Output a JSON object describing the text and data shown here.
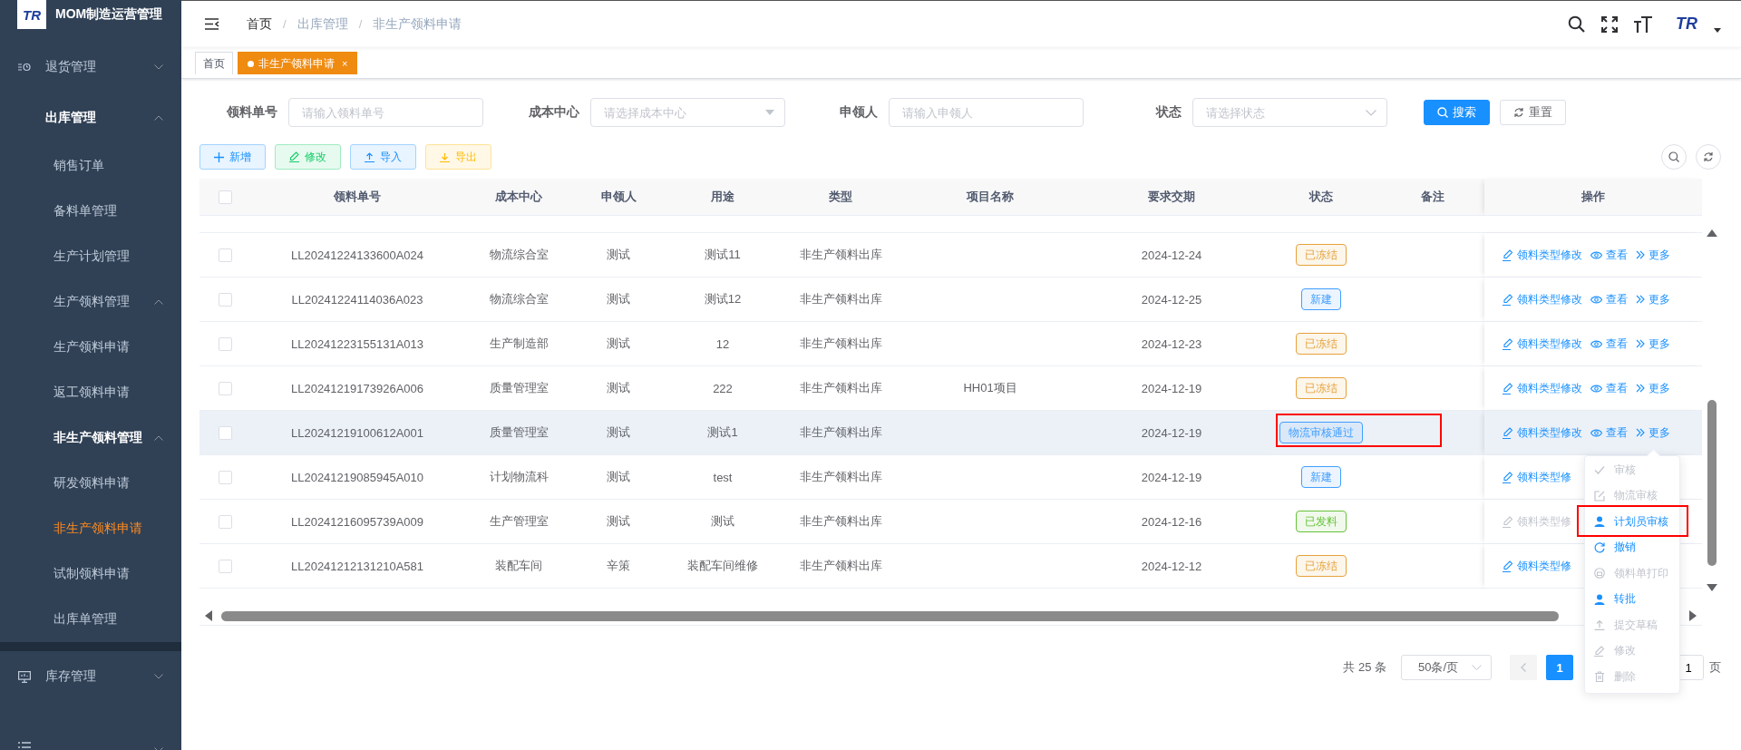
{
  "app": {
    "logo": "TR",
    "title": "MOM制造运营管理"
  },
  "menu": [
    {
      "label": "退货管理",
      "expanded": false
    },
    {
      "label": "出库管理",
      "expanded": true,
      "children": [
        {
          "label": "销售订单",
          "selected": false
        },
        {
          "label": "备料单管理",
          "selected": false
        },
        {
          "label": "生产计划管理",
          "selected": false
        },
        {
          "label": "生产领料管理",
          "expanded": true,
          "children": [
            {
              "label": "生产领料申请",
              "selected": false
            },
            {
              "label": "返工领料申请",
              "selected": false
            }
          ]
        },
        {
          "label": "非生产领料管理",
          "expanded": true,
          "children": [
            {
              "label": "研发领料申请",
              "selected": false
            },
            {
              "label": "非生产领料申请",
              "selected": true
            },
            {
              "label": "试制领料申请",
              "selected": false
            }
          ]
        },
        {
          "label": "出库单管理",
          "selected": false
        }
      ]
    },
    {
      "label": "库存管理",
      "expanded": false
    }
  ],
  "breadcrumb": [
    {
      "label": "首页"
    },
    {
      "separator": "/",
      "label": "出库管理"
    },
    {
      "separator": "/",
      "label": "非生产领料申请"
    }
  ],
  "header_logo": "TR",
  "tabs": [
    {
      "label": "首页",
      "selected": false
    },
    {
      "label": "非生产领料申请",
      "selected": true,
      "close": "×"
    }
  ],
  "filters": [
    {
      "label": "领料单号",
      "placeholder": "请输入领料单号",
      "kind": "input"
    },
    {
      "label": "成本中心",
      "placeholder": "请选择成本中心",
      "kind": "tree-select"
    },
    {
      "label": "申领人",
      "placeholder": "请输入申领人",
      "kind": "input"
    },
    {
      "label": "状态",
      "placeholder": "请选择状态",
      "kind": "select"
    }
  ],
  "search_buttons": [
    {
      "label": "搜索",
      "kind": "primary"
    },
    {
      "label": "重置",
      "kind": "default"
    }
  ],
  "toolbar": [
    {
      "label": "新增",
      "kind": "add"
    },
    {
      "label": "修改",
      "kind": "edit"
    },
    {
      "label": "导入",
      "kind": "import"
    },
    {
      "label": "导出",
      "kind": "export"
    }
  ],
  "table": {
    "all_checked": false,
    "columns": [
      "领料单号",
      "成本中心",
      "申领人",
      "用途",
      "类型",
      "项目名称",
      "要求交期",
      "状态",
      "备注",
      "操作"
    ],
    "rows": [
      {
        "checked": false,
        "hovered": false,
        "no": "LL20241224133600A024",
        "cost_center": "物流综合室",
        "applicant": "测试",
        "purpose": "测试11",
        "type": "非生产领料出库",
        "due": "2024-12-24",
        "status": {
          "label": "已冻结",
          "color": "#e6a23c"
        },
        "status_marked": false,
        "actions": [
          {
            "label": "领料类型修改",
            "kind": "edit",
            "disabled": false
          },
          {
            "label": "查看",
            "kind": "view",
            "disabled": false
          },
          {
            "label": "更多",
            "kind": "more",
            "disabled": false
          }
        ]
      },
      {
        "checked": false,
        "hovered": false,
        "no": "LL20241224114036A023",
        "cost_center": "物流综合室",
        "applicant": "测试",
        "purpose": "测试12",
        "type": "非生产领料出库",
        "due": "2024-12-25",
        "status": {
          "label": "新建",
          "color": "#409eff"
        },
        "status_marked": false,
        "actions": [
          {
            "label": "领料类型修改",
            "kind": "edit",
            "disabled": false
          },
          {
            "label": "查看",
            "kind": "view",
            "disabled": false
          },
          {
            "label": "更多",
            "kind": "more",
            "disabled": false
          }
        ]
      },
      {
        "checked": false,
        "hovered": false,
        "no": "LL20241223155131A013",
        "cost_center": "生产制造部",
        "applicant": "测试",
        "purpose": "12",
        "type": "非生产领料出库",
        "due": "2024-12-23",
        "status": {
          "label": "已冻结",
          "color": "#e6a23c"
        },
        "status_marked": false,
        "actions": [
          {
            "label": "领料类型修改",
            "kind": "edit",
            "disabled": false
          },
          {
            "label": "查看",
            "kind": "view",
            "disabled": false
          },
          {
            "label": "更多",
            "kind": "more",
            "disabled": false
          }
        ]
      },
      {
        "checked": false,
        "hovered": false,
        "no": "LL20241219173926A006",
        "cost_center": "质量管理室",
        "applicant": "测试",
        "purpose": "222",
        "type": "非生产领料出库",
        "project": "HH01项目",
        "due": "2024-12-19",
        "status": {
          "label": "已冻结",
          "color": "#e6a23c"
        },
        "status_marked": false,
        "actions": [
          {
            "label": "领料类型修改",
            "kind": "edit",
            "disabled": false
          },
          {
            "label": "查看",
            "kind": "view",
            "disabled": false
          },
          {
            "label": "更多",
            "kind": "more",
            "disabled": false
          }
        ]
      },
      {
        "checked": false,
        "hovered": true,
        "no": "LL20241219100612A001",
        "cost_center": "质量管理室",
        "applicant": "测试",
        "purpose": "测试1",
        "type": "非生产领料出库",
        "due": "2024-12-19",
        "status": {
          "label": "物流审核通过",
          "color": "#409eff"
        },
        "status_marked": true,
        "actions": [
          {
            "label": "领料类型修改",
            "kind": "edit",
            "disabled": false
          },
          {
            "label": "查看",
            "kind": "view",
            "disabled": false
          },
          {
            "label": "更多",
            "kind": "more",
            "disabled": false
          }
        ]
      },
      {
        "checked": false,
        "hovered": false,
        "no": "LL20241219085945A010",
        "cost_center": "计划物流科",
        "applicant": "测试",
        "purpose": "test",
        "type": "非生产领料出库",
        "due": "2024-12-19",
        "status": {
          "label": "新建",
          "color": "#409eff"
        },
        "status_marked": false,
        "actions": [
          {
            "label": "领料类型修",
            "kind": "edit",
            "disabled": false
          }
        ]
      },
      {
        "checked": false,
        "hovered": false,
        "no": "LL20241216095739A009",
        "cost_center": "生产管理室",
        "applicant": "测试",
        "purpose": "测试",
        "type": "非生产领料出库",
        "due": "2024-12-16",
        "status": {
          "label": "已发料",
          "color": "#67c23a"
        },
        "status_marked": false,
        "actions": [
          {
            "label": "领料类型修",
            "kind": "edit",
            "disabled": true
          }
        ]
      },
      {
        "checked": false,
        "hovered": false,
        "no": "LL20241212131210A581",
        "cost_center": "装配车间",
        "applicant": "辛策",
        "purpose": "装配车间维修",
        "type": "非生产领料出库",
        "due": "2024-12-12",
        "status": {
          "label": "已冻结",
          "color": "#e6a23c"
        },
        "status_marked": false,
        "actions": [
          {
            "label": "领料类型修",
            "kind": "edit",
            "disabled": false
          }
        ]
      }
    ]
  },
  "row_menu": {
    "items": [
      {
        "label": "审核",
        "kind": "check",
        "disabled": true,
        "marked": false
      },
      {
        "label": "物流审核",
        "kind": "edit",
        "disabled": true,
        "marked": false
      },
      {
        "label": "计划员审核",
        "kind": "user",
        "disabled": false,
        "marked": true
      },
      {
        "label": "撤销",
        "kind": "undo",
        "disabled": false,
        "marked": false
      },
      {
        "label": "领料单打印",
        "kind": "print",
        "disabled": true,
        "marked": false
      },
      {
        "label": "转批",
        "kind": "user",
        "disabled": false,
        "marked": false
      },
      {
        "label": "提交草稿",
        "kind": "upload",
        "disabled": true,
        "marked": false
      },
      {
        "label": "修改",
        "kind": "pen",
        "disabled": true,
        "marked": false
      },
      {
        "label": "删除",
        "kind": "trash",
        "disabled": true,
        "marked": false
      }
    ]
  },
  "pagination": {
    "total": "共 25 条",
    "page_size": "50条/页",
    "prev_disabled": true,
    "pages": [
      {
        "label": "1",
        "selected": true
      }
    ],
    "jump_value": "1",
    "jump_suffix": "页"
  }
}
